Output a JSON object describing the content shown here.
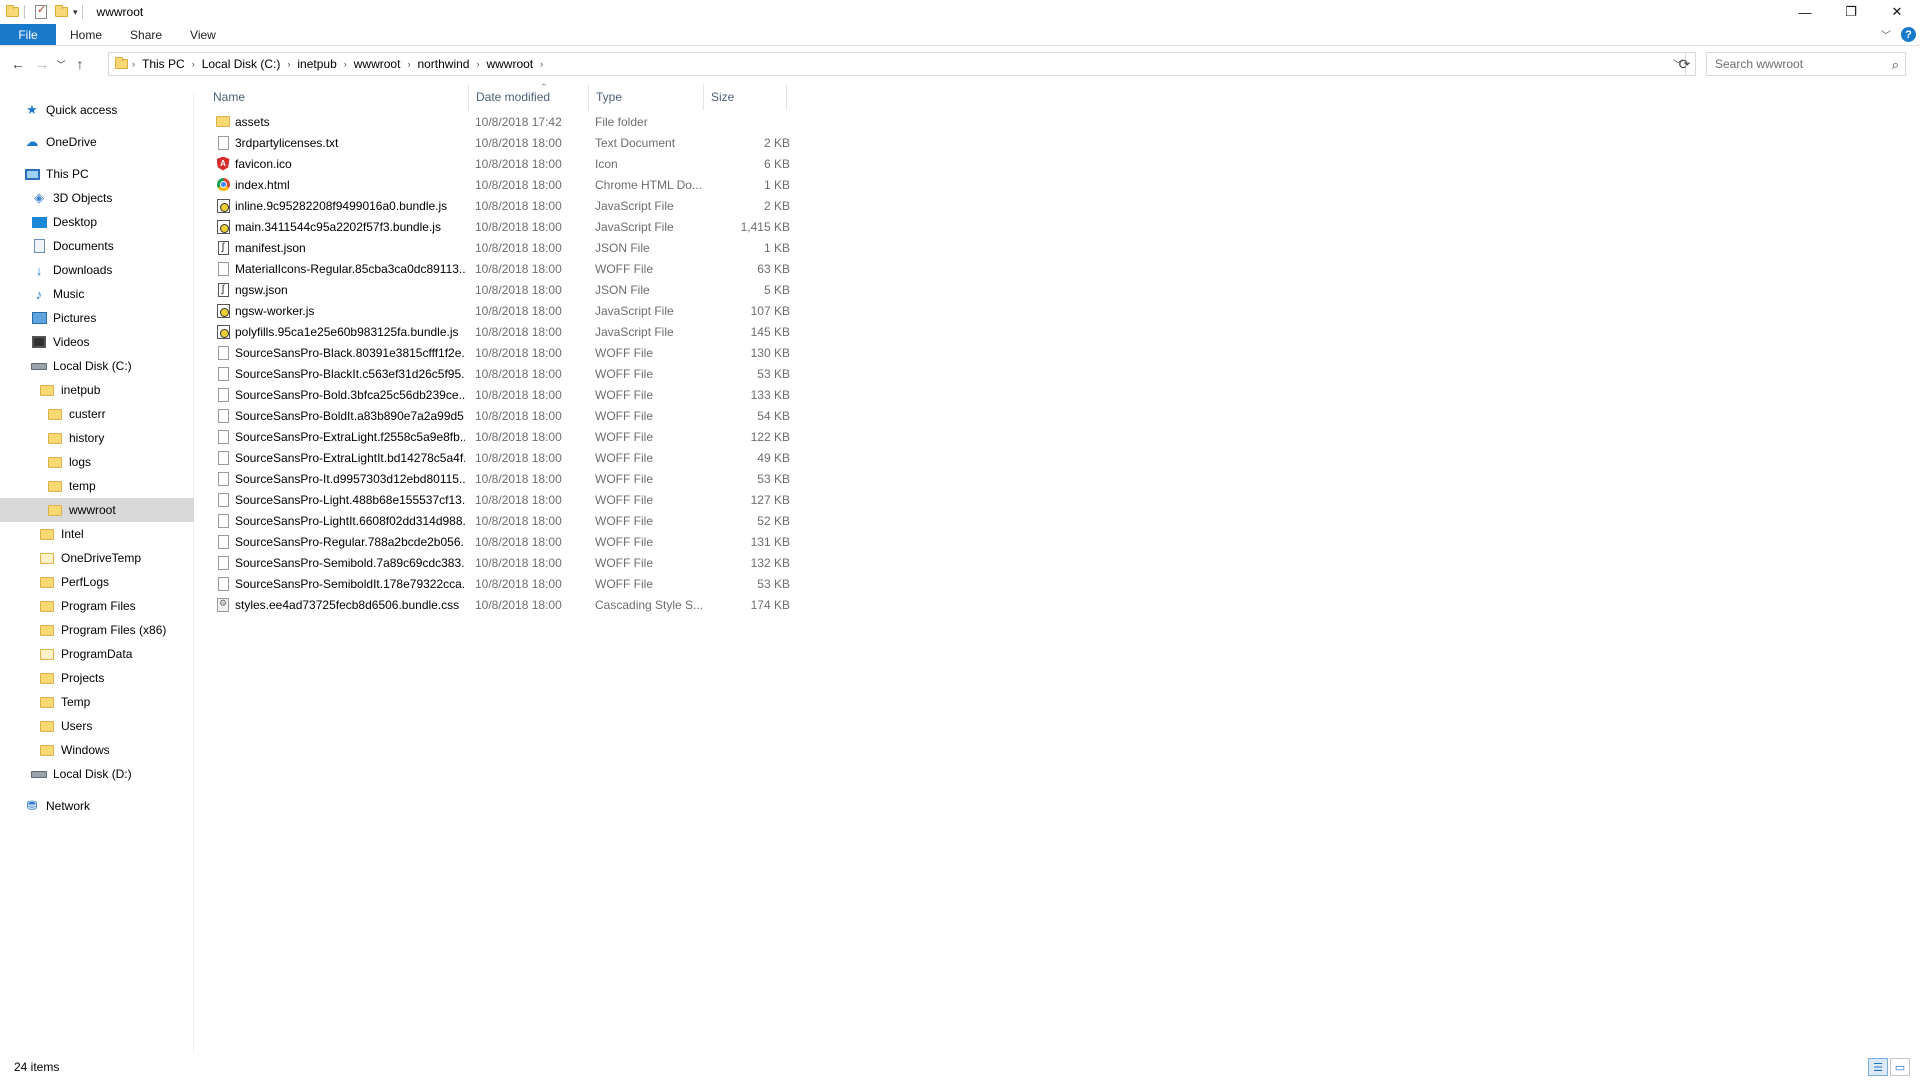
{
  "titlebar": {
    "title": "wwwroot",
    "minimize_glyph": "—",
    "restore_glyph": "❐",
    "close_glyph": "✕"
  },
  "ribbon": {
    "tabs": [
      {
        "label": "File"
      },
      {
        "label": "Home"
      },
      {
        "label": "Share"
      },
      {
        "label": "View"
      }
    ],
    "help": "?"
  },
  "address": {
    "crumbs": [
      "This PC",
      "Local Disk (C:)",
      "inetpub",
      "wwwroot",
      "northwind",
      "wwwroot"
    ]
  },
  "search": {
    "placeholder": "Search wwwroot"
  },
  "sidebar": {
    "items": [
      {
        "label": "Quick access",
        "icon": "star-icon"
      },
      {
        "label": "OneDrive",
        "icon": "cloud-icon"
      },
      {
        "label": "This PC",
        "icon": "computer-icon"
      },
      {
        "label": "3D Objects",
        "icon": "cube-icon"
      },
      {
        "label": "Desktop",
        "icon": "desktop-icon"
      },
      {
        "label": "Documents",
        "icon": "document-icon"
      },
      {
        "label": "Downloads",
        "icon": "download-arrow-icon"
      },
      {
        "label": "Music",
        "icon": "music-note-icon"
      },
      {
        "label": "Pictures",
        "icon": "picture-icon"
      },
      {
        "label": "Videos",
        "icon": "film-icon"
      },
      {
        "label": "Local Disk (C:)",
        "icon": "drive-icon"
      },
      {
        "label": "inetpub",
        "icon": "folder-icon"
      },
      {
        "label": "custerr",
        "icon": "folder-icon"
      },
      {
        "label": "history",
        "icon": "folder-icon"
      },
      {
        "label": "logs",
        "icon": "folder-icon"
      },
      {
        "label": "temp",
        "icon": "folder-icon"
      },
      {
        "label": "wwwroot",
        "icon": "folder-icon"
      },
      {
        "label": "Intel",
        "icon": "folder-icon"
      },
      {
        "label": "OneDriveTemp",
        "icon": "folder-icon"
      },
      {
        "label": "PerfLogs",
        "icon": "folder-icon"
      },
      {
        "label": "Program Files",
        "icon": "folder-icon"
      },
      {
        "label": "Program Files (x86)",
        "icon": "folder-icon"
      },
      {
        "label": "ProgramData",
        "icon": "folder-icon"
      },
      {
        "label": "Projects",
        "icon": "folder-icon"
      },
      {
        "label": "Temp",
        "icon": "folder-icon"
      },
      {
        "label": "Users",
        "icon": "folder-icon"
      },
      {
        "label": "Windows",
        "icon": "folder-icon"
      },
      {
        "label": "Local Disk (D:)",
        "icon": "drive-icon"
      },
      {
        "label": "Network",
        "icon": "network-icon"
      }
    ],
    "selected": "wwwroot"
  },
  "columns": {
    "name": "Name",
    "date": "Date modified",
    "type": "Type",
    "size": "Size"
  },
  "files": [
    {
      "name": "assets",
      "date": "10/8/2018 17:42",
      "type": "File folder",
      "size": "",
      "icon": "folder-icon"
    },
    {
      "name": "3rdpartylicenses.txt",
      "date": "10/8/2018 18:00",
      "type": "Text Document",
      "size": "2 KB",
      "icon": "text-file-icon"
    },
    {
      "name": "favicon.ico",
      "date": "10/8/2018 18:00",
      "type": "Icon",
      "size": "6 KB",
      "icon": "angular-icon"
    },
    {
      "name": "index.html",
      "date": "10/8/2018 18:00",
      "type": "Chrome HTML Do...",
      "size": "1 KB",
      "icon": "chrome-icon"
    },
    {
      "name": "inline.9c95282208f9499016a0.bundle.js",
      "date": "10/8/2018 18:00",
      "type": "JavaScript File",
      "size": "2 KB",
      "icon": "script-file-icon"
    },
    {
      "name": "main.3411544c95a2202f57f3.bundle.js",
      "date": "10/8/2018 18:00",
      "type": "JavaScript File",
      "size": "1,415 KB",
      "icon": "script-file-icon"
    },
    {
      "name": "manifest.json",
      "date": "10/8/2018 18:00",
      "type": "JSON File",
      "size": "1 KB",
      "icon": "json-file-icon"
    },
    {
      "name": "MaterialIcons-Regular.85cba3ca0dc89113...",
      "date": "10/8/2018 18:00",
      "type": "WOFF File",
      "size": "63 KB",
      "icon": "blank-file-icon"
    },
    {
      "name": "ngsw.json",
      "date": "10/8/2018 18:00",
      "type": "JSON File",
      "size": "5 KB",
      "icon": "json-file-icon"
    },
    {
      "name": "ngsw-worker.js",
      "date": "10/8/2018 18:00",
      "type": "JavaScript File",
      "size": "107 KB",
      "icon": "script-file-icon"
    },
    {
      "name": "polyfills.95ca1e25e60b983125fa.bundle.js",
      "date": "10/8/2018 18:00",
      "type": "JavaScript File",
      "size": "145 KB",
      "icon": "script-file-icon"
    },
    {
      "name": "SourceSansPro-Black.80391e3815cfff1f2e...",
      "date": "10/8/2018 18:00",
      "type": "WOFF File",
      "size": "130 KB",
      "icon": "blank-file-icon"
    },
    {
      "name": "SourceSansPro-BlackIt.c563ef31d26c5f95...",
      "date": "10/8/2018 18:00",
      "type": "WOFF File",
      "size": "53 KB",
      "icon": "blank-file-icon"
    },
    {
      "name": "SourceSansPro-Bold.3bfca25c56db239ce...",
      "date": "10/8/2018 18:00",
      "type": "WOFF File",
      "size": "133 KB",
      "icon": "blank-file-icon"
    },
    {
      "name": "SourceSansPro-BoldIt.a83b890e7a2a99d5...",
      "date": "10/8/2018 18:00",
      "type": "WOFF File",
      "size": "54 KB",
      "icon": "blank-file-icon"
    },
    {
      "name": "SourceSansPro-ExtraLight.f2558c5a9e8fb...",
      "date": "10/8/2018 18:00",
      "type": "WOFF File",
      "size": "122 KB",
      "icon": "blank-file-icon"
    },
    {
      "name": "SourceSansPro-ExtraLightIt.bd14278c5a4f...",
      "date": "10/8/2018 18:00",
      "type": "WOFF File",
      "size": "49 KB",
      "icon": "blank-file-icon"
    },
    {
      "name": "SourceSansPro-It.d9957303d12ebd80115...",
      "date": "10/8/2018 18:00",
      "type": "WOFF File",
      "size": "53 KB",
      "icon": "blank-file-icon"
    },
    {
      "name": "SourceSansPro-Light.488b68e155537cf13...",
      "date": "10/8/2018 18:00",
      "type": "WOFF File",
      "size": "127 KB",
      "icon": "blank-file-icon"
    },
    {
      "name": "SourceSansPro-LightIt.6608f02dd314d988...",
      "date": "10/8/2018 18:00",
      "type": "WOFF File",
      "size": "52 KB",
      "icon": "blank-file-icon"
    },
    {
      "name": "SourceSansPro-Regular.788a2bcde2b056...",
      "date": "10/8/2018 18:00",
      "type": "WOFF File",
      "size": "131 KB",
      "icon": "blank-file-icon"
    },
    {
      "name": "SourceSansPro-Semibold.7a89c69cdc383...",
      "date": "10/8/2018 18:00",
      "type": "WOFF File",
      "size": "132 KB",
      "icon": "blank-file-icon"
    },
    {
      "name": "SourceSansPro-SemiboldIt.178e79322cca...",
      "date": "10/8/2018 18:00",
      "type": "WOFF File",
      "size": "53 KB",
      "icon": "blank-file-icon"
    },
    {
      "name": "styles.ee4ad73725fecb8d6506.bundle.css",
      "date": "10/8/2018 18:00",
      "type": "Cascading Style S...",
      "size": "174 KB",
      "icon": "stylesheet-icon"
    }
  ],
  "status": {
    "item_count": "24 items"
  },
  "colors": {
    "accent": "#1979ca",
    "selection": "#d9d9d9",
    "header_text": "#4c607a",
    "meta_text": "#6d6d6d"
  }
}
